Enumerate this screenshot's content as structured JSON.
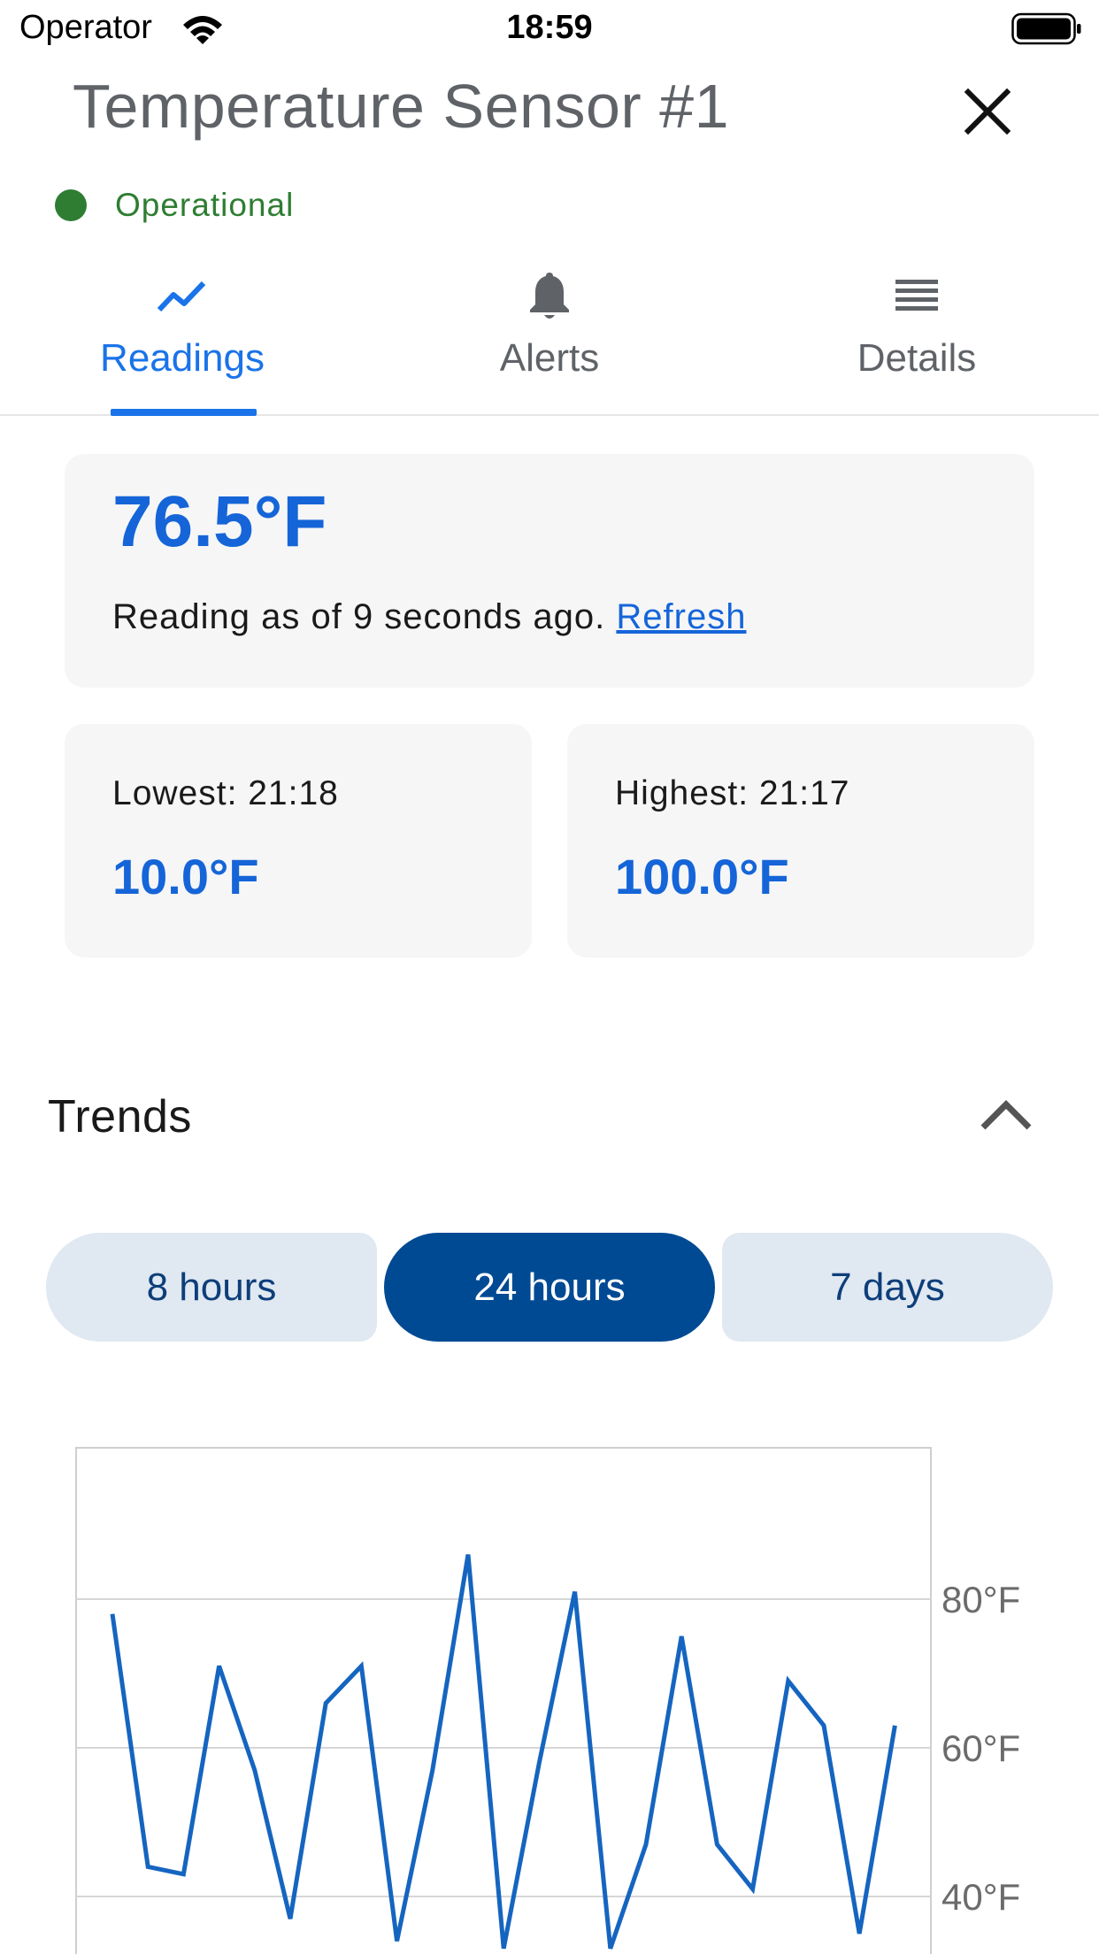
{
  "status_bar": {
    "carrier": "Operator",
    "time": "18:59"
  },
  "header": {
    "title": "Temperature Sensor #1",
    "close_icon": "close-icon"
  },
  "status": {
    "text": "Operational",
    "color": "#2e7d32"
  },
  "tabs": [
    {
      "label": "Readings",
      "icon": "trend-line-icon",
      "active": true
    },
    {
      "label": "Alerts",
      "icon": "bell-icon",
      "active": false
    },
    {
      "label": "Details",
      "icon": "list-icon",
      "active": false
    }
  ],
  "current": {
    "value": "76.5°F",
    "reading_text": "Reading as of 9 seconds ago.",
    "refresh_label": "Refresh"
  },
  "lowest": {
    "label": "Lowest: 21:18",
    "value": "10.0°F"
  },
  "highest": {
    "label": "Highest: 21:17",
    "value": "100.0°F"
  },
  "trends": {
    "title": "Trends",
    "toggle_icon": "chevron-up-icon",
    "ranges": [
      {
        "label": "8 hours",
        "selected": false
      },
      {
        "label": "24 hours",
        "selected": true
      },
      {
        "label": "7 days",
        "selected": false
      }
    ]
  },
  "colors": {
    "accent": "#1565d8",
    "selected_segment": "#004a94",
    "segment_bg": "#e0e8f1",
    "line": "#1565c0"
  },
  "chart_data": {
    "type": "line",
    "title": "",
    "xlabel": "",
    "ylabel": "",
    "ytick_labels": [
      "80°F",
      "60°F",
      "40°F"
    ],
    "y_ticks": [
      80,
      60,
      40
    ],
    "grid": true,
    "series": [
      {
        "values": [
          78,
          44,
          43,
          71,
          57,
          37,
          66,
          71,
          34,
          57,
          86,
          33,
          58,
          81,
          33,
          47,
          75,
          47,
          41,
          69,
          63,
          35,
          63
        ]
      }
    ]
  }
}
